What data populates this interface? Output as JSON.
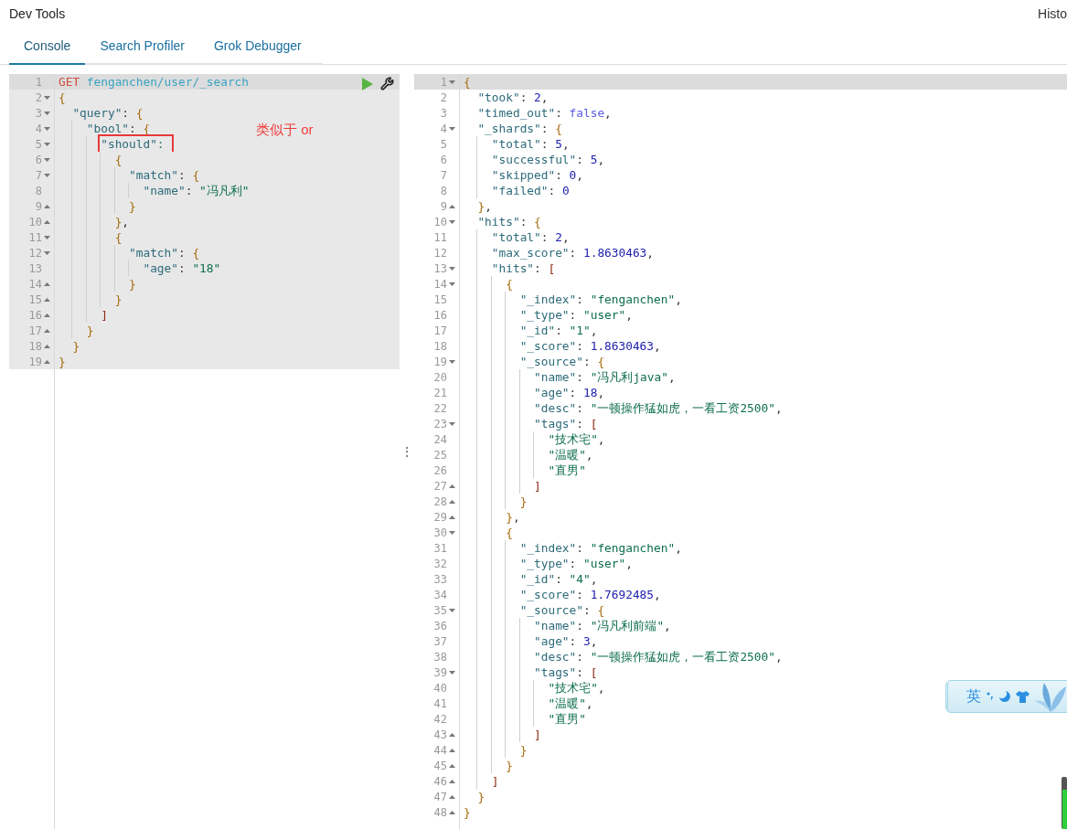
{
  "app": {
    "title": "Dev Tools",
    "history_link": "Histo"
  },
  "tabs": [
    {
      "label": "Console",
      "selected": true
    },
    {
      "label": "Search Profiler",
      "selected": false
    },
    {
      "label": "Grok Debugger",
      "selected": false
    }
  ],
  "request_editor": {
    "text_selected": true,
    "annotation": "类似于 or",
    "lines": [
      {
        "n": "1",
        "kind": "plain",
        "active": true,
        "tokens": [
          {
            "kind": "method",
            "text": "GET"
          },
          {
            "kind": "url",
            "text": " fenganchen/user/_search"
          }
        ]
      },
      {
        "n": "2",
        "kind": "block_start",
        "active": false,
        "tokens": [
          {
            "kind": "brace",
            "text": "{"
          }
        ]
      },
      {
        "n": "3",
        "kind": "block_start",
        "active": false,
        "tokens": [
          {
            "kind": "key",
            "text": "\"query\""
          },
          {
            "kind": "punct",
            "text": ": "
          },
          {
            "kind": "brace",
            "text": "{"
          }
        ]
      },
      {
        "n": "4",
        "kind": "block_start",
        "active": false,
        "tokens": [
          {
            "kind": "key",
            "text": "\"bool\""
          },
          {
            "kind": "punct",
            "text": ": "
          },
          {
            "kind": "brace",
            "text": "{"
          }
        ]
      },
      {
        "n": "5",
        "kind": "block_start",
        "active": false,
        "tokens": [
          {
            "kind": "boxed",
            "text": "\"should\": "
          }
        ]
      },
      {
        "n": "6",
        "kind": "block_start",
        "active": false,
        "tokens": [
          {
            "kind": "brace",
            "text": "{"
          }
        ]
      },
      {
        "n": "7",
        "kind": "block_start",
        "active": false,
        "tokens": [
          {
            "kind": "key",
            "text": "\"match\""
          },
          {
            "kind": "punct",
            "text": ": "
          },
          {
            "kind": "brace",
            "text": "{"
          }
        ]
      },
      {
        "n": "8",
        "kind": "plain",
        "active": false,
        "tokens": [
          {
            "kind": "key",
            "text": "\"name\""
          },
          {
            "kind": "punct",
            "text": ": "
          },
          {
            "kind": "str",
            "text": "\"冯凡利\""
          }
        ]
      },
      {
        "n": "9",
        "kind": "block_end",
        "active": false,
        "tokens": [
          {
            "kind": "brace",
            "text": "}"
          }
        ]
      },
      {
        "n": "10",
        "kind": "block_end",
        "active": false,
        "tokens": [
          {
            "kind": "brace",
            "text": "}"
          },
          {
            "kind": "punct",
            "text": ","
          }
        ]
      },
      {
        "n": "11",
        "kind": "block_start",
        "active": false,
        "tokens": [
          {
            "kind": "brace",
            "text": "{"
          }
        ]
      },
      {
        "n": "12",
        "kind": "block_start",
        "active": false,
        "tokens": [
          {
            "kind": "key",
            "text": "\"match\""
          },
          {
            "kind": "punct",
            "text": ": "
          },
          {
            "kind": "brace",
            "text": "{"
          }
        ]
      },
      {
        "n": "13",
        "kind": "plain",
        "active": false,
        "tokens": [
          {
            "kind": "key",
            "text": "\"age\""
          },
          {
            "kind": "punct",
            "text": ": "
          },
          {
            "kind": "str",
            "text": "\"18\""
          }
        ]
      },
      {
        "n": "14",
        "kind": "block_end",
        "active": false,
        "tokens": [
          {
            "kind": "brace",
            "text": "}"
          }
        ]
      },
      {
        "n": "15",
        "kind": "block_end",
        "active": false,
        "tokens": [
          {
            "kind": "brace",
            "text": "}"
          }
        ]
      },
      {
        "n": "16",
        "kind": "block_end",
        "active": false,
        "tokens": [
          {
            "kind": "bracket",
            "text": "]"
          }
        ]
      },
      {
        "n": "17",
        "kind": "block_end",
        "active": false,
        "tokens": [
          {
            "kind": "brace",
            "text": "}"
          }
        ]
      },
      {
        "n": "18",
        "kind": "block_end",
        "active": false,
        "tokens": [
          {
            "kind": "brace",
            "text": "}"
          }
        ]
      },
      {
        "n": "19",
        "kind": "block_end",
        "active": false,
        "tokens": [
          {
            "kind": "brace",
            "text": "}"
          }
        ]
      }
    ]
  },
  "splitter": {
    "glyph": "⋮"
  },
  "response_editor": {
    "text_selected": false,
    "lines": [
      {
        "n": "1",
        "kind": "block_start",
        "active": true,
        "tokens": [
          {
            "kind": "brace",
            "text": "{"
          }
        ]
      },
      {
        "n": "2",
        "kind": "plain",
        "active": false,
        "tokens": [
          {
            "kind": "key",
            "text": "\"took\""
          },
          {
            "kind": "punct",
            "text": ": "
          },
          {
            "kind": "num",
            "text": "2"
          },
          {
            "kind": "punct",
            "text": ","
          }
        ]
      },
      {
        "n": "3",
        "kind": "plain",
        "active": false,
        "tokens": [
          {
            "kind": "key",
            "text": "\"timed_out\""
          },
          {
            "kind": "punct",
            "text": ": "
          },
          {
            "kind": "bool",
            "text": "false"
          },
          {
            "kind": "punct",
            "text": ","
          }
        ]
      },
      {
        "n": "4",
        "kind": "block_start",
        "active": false,
        "tokens": [
          {
            "kind": "key",
            "text": "\"_shards\""
          },
          {
            "kind": "punct",
            "text": ": "
          },
          {
            "kind": "brace",
            "text": "{"
          }
        ]
      },
      {
        "n": "5",
        "kind": "plain",
        "active": false,
        "tokens": [
          {
            "kind": "key",
            "text": "\"total\""
          },
          {
            "kind": "punct",
            "text": ": "
          },
          {
            "kind": "num",
            "text": "5"
          },
          {
            "kind": "punct",
            "text": ","
          }
        ]
      },
      {
        "n": "6",
        "kind": "plain",
        "active": false,
        "tokens": [
          {
            "kind": "key",
            "text": "\"successful\""
          },
          {
            "kind": "punct",
            "text": ": "
          },
          {
            "kind": "num",
            "text": "5"
          },
          {
            "kind": "punct",
            "text": ","
          }
        ]
      },
      {
        "n": "7",
        "kind": "plain",
        "active": false,
        "tokens": [
          {
            "kind": "key",
            "text": "\"skipped\""
          },
          {
            "kind": "punct",
            "text": ": "
          },
          {
            "kind": "num",
            "text": "0"
          },
          {
            "kind": "punct",
            "text": ","
          }
        ]
      },
      {
        "n": "8",
        "kind": "plain",
        "active": false,
        "tokens": [
          {
            "kind": "key",
            "text": "\"failed\""
          },
          {
            "kind": "punct",
            "text": ": "
          },
          {
            "kind": "num",
            "text": "0"
          }
        ]
      },
      {
        "n": "9",
        "kind": "block_end",
        "active": false,
        "tokens": [
          {
            "kind": "brace",
            "text": "}"
          },
          {
            "kind": "punct",
            "text": ","
          }
        ]
      },
      {
        "n": "10",
        "kind": "block_start",
        "active": false,
        "tokens": [
          {
            "kind": "key",
            "text": "\"hits\""
          },
          {
            "kind": "punct",
            "text": ": "
          },
          {
            "kind": "brace",
            "text": "{"
          }
        ]
      },
      {
        "n": "11",
        "kind": "plain",
        "active": false,
        "tokens": [
          {
            "kind": "key",
            "text": "\"total\""
          },
          {
            "kind": "punct",
            "text": ": "
          },
          {
            "kind": "num",
            "text": "2"
          },
          {
            "kind": "punct",
            "text": ","
          }
        ]
      },
      {
        "n": "12",
        "kind": "plain",
        "active": false,
        "tokens": [
          {
            "kind": "key",
            "text": "\"max_score\""
          },
          {
            "kind": "punct",
            "text": ": "
          },
          {
            "kind": "num",
            "text": "1.8630463"
          },
          {
            "kind": "punct",
            "text": ","
          }
        ]
      },
      {
        "n": "13",
        "kind": "block_start",
        "active": false,
        "tokens": [
          {
            "kind": "key",
            "text": "\"hits\""
          },
          {
            "kind": "punct",
            "text": ": "
          },
          {
            "kind": "bracket",
            "text": "["
          }
        ]
      },
      {
        "n": "14",
        "kind": "block_start",
        "active": false,
        "tokens": [
          {
            "kind": "brace",
            "text": "{"
          }
        ]
      },
      {
        "n": "15",
        "kind": "plain",
        "active": false,
        "tokens": [
          {
            "kind": "key",
            "text": "\"_index\""
          },
          {
            "kind": "punct",
            "text": ": "
          },
          {
            "kind": "str",
            "text": "\"fenganchen\""
          },
          {
            "kind": "punct",
            "text": ","
          }
        ]
      },
      {
        "n": "16",
        "kind": "plain",
        "active": false,
        "tokens": [
          {
            "kind": "key",
            "text": "\"_type\""
          },
          {
            "kind": "punct",
            "text": ": "
          },
          {
            "kind": "str",
            "text": "\"user\""
          },
          {
            "kind": "punct",
            "text": ","
          }
        ]
      },
      {
        "n": "17",
        "kind": "plain",
        "active": false,
        "tokens": [
          {
            "kind": "key",
            "text": "\"_id\""
          },
          {
            "kind": "punct",
            "text": ": "
          },
          {
            "kind": "str",
            "text": "\"1\""
          },
          {
            "kind": "punct",
            "text": ","
          }
        ]
      },
      {
        "n": "18",
        "kind": "plain",
        "active": false,
        "tokens": [
          {
            "kind": "key",
            "text": "\"_score\""
          },
          {
            "kind": "punct",
            "text": ": "
          },
          {
            "kind": "num",
            "text": "1.8630463"
          },
          {
            "kind": "punct",
            "text": ","
          }
        ]
      },
      {
        "n": "19",
        "kind": "block_start",
        "active": false,
        "tokens": [
          {
            "kind": "key",
            "text": "\"_source\""
          },
          {
            "kind": "punct",
            "text": ": "
          },
          {
            "kind": "brace",
            "text": "{"
          }
        ]
      },
      {
        "n": "20",
        "kind": "plain",
        "active": false,
        "tokens": [
          {
            "kind": "key",
            "text": "\"name\""
          },
          {
            "kind": "punct",
            "text": ": "
          },
          {
            "kind": "str",
            "text": "\"冯凡利java\""
          },
          {
            "kind": "punct",
            "text": ","
          }
        ]
      },
      {
        "n": "21",
        "kind": "plain",
        "active": false,
        "tokens": [
          {
            "kind": "key",
            "text": "\"age\""
          },
          {
            "kind": "punct",
            "text": ": "
          },
          {
            "kind": "num",
            "text": "18"
          },
          {
            "kind": "punct",
            "text": ","
          }
        ]
      },
      {
        "n": "22",
        "kind": "plain",
        "active": false,
        "tokens": [
          {
            "kind": "key",
            "text": "\"desc\""
          },
          {
            "kind": "punct",
            "text": ": "
          },
          {
            "kind": "str",
            "text": "\"一顿操作猛如虎，一看工资2500\""
          },
          {
            "kind": "punct",
            "text": ","
          }
        ]
      },
      {
        "n": "23",
        "kind": "block_start",
        "active": false,
        "tokens": [
          {
            "kind": "key",
            "text": "\"tags\""
          },
          {
            "kind": "punct",
            "text": ": "
          },
          {
            "kind": "bracket",
            "text": "["
          }
        ]
      },
      {
        "n": "24",
        "kind": "plain",
        "active": false,
        "tokens": [
          {
            "kind": "str",
            "text": "\"技术宅\""
          },
          {
            "kind": "punct",
            "text": ","
          }
        ]
      },
      {
        "n": "25",
        "kind": "plain",
        "active": false,
        "tokens": [
          {
            "kind": "str",
            "text": "\"温暖\""
          },
          {
            "kind": "punct",
            "text": ","
          }
        ]
      },
      {
        "n": "26",
        "kind": "plain",
        "active": false,
        "tokens": [
          {
            "kind": "str",
            "text": "\"直男\""
          }
        ]
      },
      {
        "n": "27",
        "kind": "block_end",
        "active": false,
        "tokens": [
          {
            "kind": "bracket",
            "text": "]"
          }
        ]
      },
      {
        "n": "28",
        "kind": "block_end",
        "active": false,
        "tokens": [
          {
            "kind": "brace",
            "text": "}"
          }
        ]
      },
      {
        "n": "29",
        "kind": "block_end",
        "active": false,
        "tokens": [
          {
            "kind": "brace",
            "text": "}"
          },
          {
            "kind": "punct",
            "text": ","
          }
        ]
      },
      {
        "n": "30",
        "kind": "block_start",
        "active": false,
        "tokens": [
          {
            "kind": "brace",
            "text": "{"
          }
        ]
      },
      {
        "n": "31",
        "kind": "plain",
        "active": false,
        "tokens": [
          {
            "kind": "key",
            "text": "\"_index\""
          },
          {
            "kind": "punct",
            "text": ": "
          },
          {
            "kind": "str",
            "text": "\"fenganchen\""
          },
          {
            "kind": "punct",
            "text": ","
          }
        ]
      },
      {
        "n": "32",
        "kind": "plain",
        "active": false,
        "tokens": [
          {
            "kind": "key",
            "text": "\"_type\""
          },
          {
            "kind": "punct",
            "text": ": "
          },
          {
            "kind": "str",
            "text": "\"user\""
          },
          {
            "kind": "punct",
            "text": ","
          }
        ]
      },
      {
        "n": "33",
        "kind": "plain",
        "active": false,
        "tokens": [
          {
            "kind": "key",
            "text": "\"_id\""
          },
          {
            "kind": "punct",
            "text": ": "
          },
          {
            "kind": "str",
            "text": "\"4\""
          },
          {
            "kind": "punct",
            "text": ","
          }
        ]
      },
      {
        "n": "34",
        "kind": "plain",
        "active": false,
        "tokens": [
          {
            "kind": "key",
            "text": "\"_score\""
          },
          {
            "kind": "punct",
            "text": ": "
          },
          {
            "kind": "num",
            "text": "1.7692485"
          },
          {
            "kind": "punct",
            "text": ","
          }
        ]
      },
      {
        "n": "35",
        "kind": "block_start",
        "active": false,
        "tokens": [
          {
            "kind": "key",
            "text": "\"_source\""
          },
          {
            "kind": "punct",
            "text": ": "
          },
          {
            "kind": "brace",
            "text": "{"
          }
        ]
      },
      {
        "n": "36",
        "kind": "plain",
        "active": false,
        "tokens": [
          {
            "kind": "key",
            "text": "\"name\""
          },
          {
            "kind": "punct",
            "text": ": "
          },
          {
            "kind": "str",
            "text": "\"冯凡利前端\""
          },
          {
            "kind": "punct",
            "text": ","
          }
        ]
      },
      {
        "n": "37",
        "kind": "plain",
        "active": false,
        "tokens": [
          {
            "kind": "key",
            "text": "\"age\""
          },
          {
            "kind": "punct",
            "text": ": "
          },
          {
            "kind": "num",
            "text": "3"
          },
          {
            "kind": "punct",
            "text": ","
          }
        ]
      },
      {
        "n": "38",
        "kind": "plain",
        "active": false,
        "tokens": [
          {
            "kind": "key",
            "text": "\"desc\""
          },
          {
            "kind": "punct",
            "text": ": "
          },
          {
            "kind": "str",
            "text": "\"一顿操作猛如虎，一看工资2500\""
          },
          {
            "kind": "punct",
            "text": ","
          }
        ]
      },
      {
        "n": "39",
        "kind": "block_start",
        "active": false,
        "tokens": [
          {
            "kind": "key",
            "text": "\"tags\""
          },
          {
            "kind": "punct",
            "text": ": "
          },
          {
            "kind": "bracket",
            "text": "["
          }
        ]
      },
      {
        "n": "40",
        "kind": "plain",
        "active": false,
        "tokens": [
          {
            "kind": "str",
            "text": "\"技术宅\""
          },
          {
            "kind": "punct",
            "text": ","
          }
        ]
      },
      {
        "n": "41",
        "kind": "plain",
        "active": false,
        "tokens": [
          {
            "kind": "str",
            "text": "\"温暖\""
          },
          {
            "kind": "punct",
            "text": ","
          }
        ]
      },
      {
        "n": "42",
        "kind": "plain",
        "active": false,
        "tokens": [
          {
            "kind": "str",
            "text": "\"直男\""
          }
        ]
      },
      {
        "n": "43",
        "kind": "block_end",
        "active": false,
        "tokens": [
          {
            "kind": "bracket",
            "text": "]"
          }
        ]
      },
      {
        "n": "44",
        "kind": "block_end",
        "active": false,
        "tokens": [
          {
            "kind": "brace",
            "text": "}"
          }
        ]
      },
      {
        "n": "45",
        "kind": "block_end",
        "active": false,
        "tokens": [
          {
            "kind": "brace",
            "text": "}"
          }
        ]
      },
      {
        "n": "46",
        "kind": "block_end",
        "active": false,
        "tokens": [
          {
            "kind": "bracket",
            "text": "]"
          }
        ]
      },
      {
        "n": "47",
        "kind": "block_end",
        "active": false,
        "tokens": [
          {
            "kind": "brace",
            "text": "}"
          }
        ]
      },
      {
        "n": "48",
        "kind": "block_end",
        "active": false,
        "tokens": [
          {
            "kind": "brace",
            "text": "}"
          }
        ]
      }
    ]
  },
  "ime_toolbar": {
    "language": "英"
  }
}
